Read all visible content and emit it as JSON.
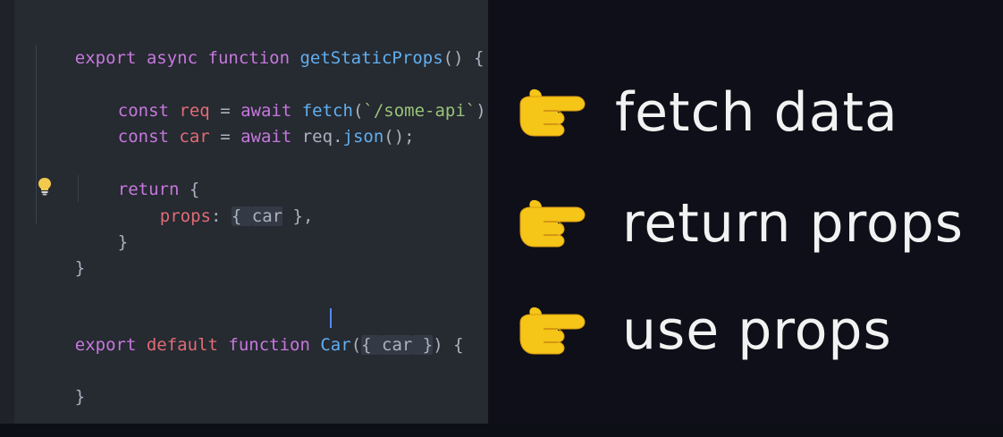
{
  "code": {
    "line1": {
      "export": "export",
      "async": "async",
      "function": "function",
      "name": "getStaticProps",
      "rest": "() {"
    },
    "line2": {
      "const": "const",
      "var": "req",
      "eq": " = ",
      "await": "await",
      "fn": "fetch",
      "open": "(",
      "str": "`/some-api`",
      "close": ");"
    },
    "line3": {
      "const": "const",
      "var": "car",
      "eq": " = ",
      "await": "await",
      "obj": "req",
      "dot": ".",
      "fn": "json",
      "close": "();"
    },
    "line4": {
      "return": "return",
      "rest": " {"
    },
    "line5": {
      "key": "props",
      "colon": ": ",
      "open": "{ ",
      "val": "car",
      "close": " },"
    },
    "line6": {
      "text": "}"
    },
    "line7": {
      "text": "}"
    },
    "line8": {
      "export": "export",
      "default": "default",
      "function": "function",
      "name": "Car",
      "paren": "(",
      "brace_open": "{ ",
      "param": "car",
      "brace_close": " }",
      "rest": ") {"
    },
    "line9": {
      "text": "}"
    }
  },
  "bullets": [
    {
      "emoji": "backhand-index-pointing-right",
      "text": "fetch data"
    },
    {
      "emoji": "backhand-index-pointing-right",
      "text": "return props"
    },
    {
      "emoji": "backhand-index-pointing-right",
      "text": "use props"
    }
  ],
  "colors": {
    "keyword": "#c678dd",
    "function": "#61afef",
    "variable": "#e06c75",
    "string": "#98c379",
    "punctuation": "#abb2bf",
    "editor_bg": "#262a31",
    "slide_bg": "#0e0f18",
    "hand": "#f5c518"
  }
}
